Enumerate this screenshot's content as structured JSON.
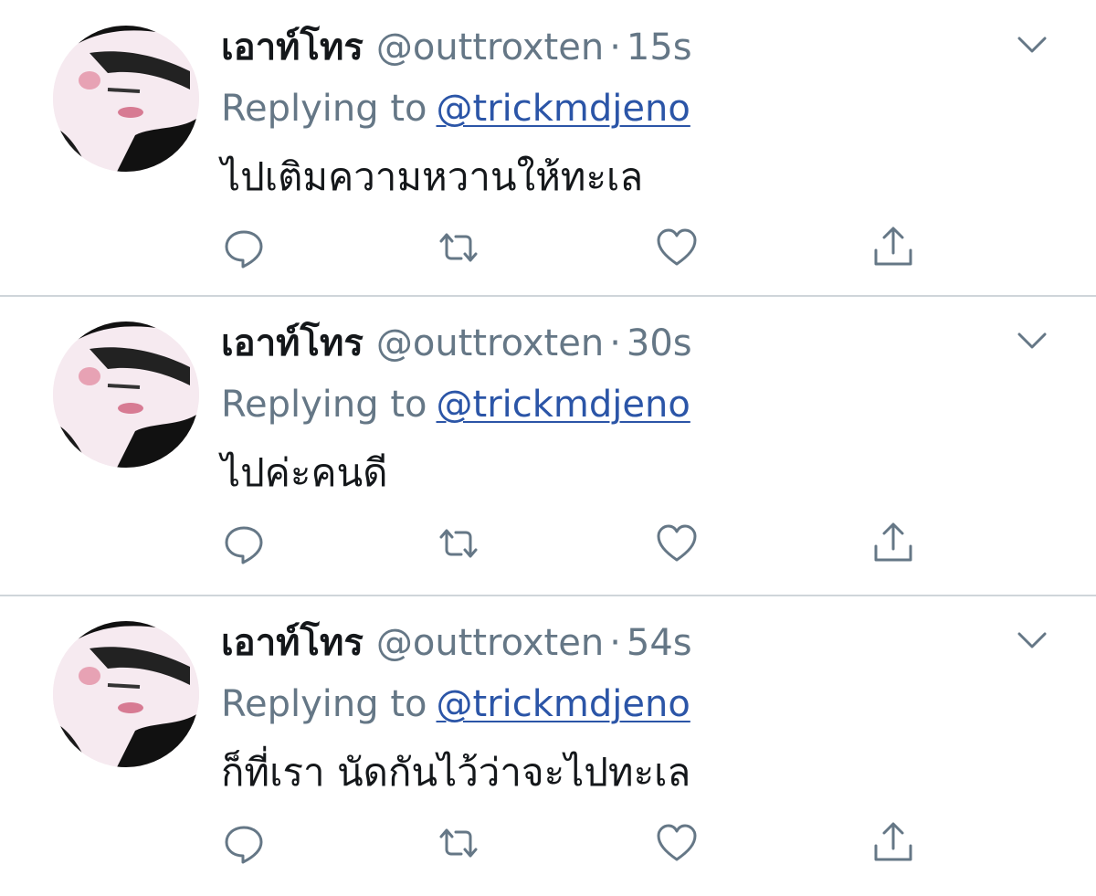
{
  "colors": {
    "name": "#14171a",
    "secondary": "#657786",
    "link": "#2b55a7",
    "divider": "#cfd5da",
    "icon": "#657786"
  },
  "icons": {
    "menu": "chevron-down-icon",
    "reply": "comment-bubble-icon",
    "retweet": "retweet-arrows-icon",
    "like": "heart-icon",
    "share": "share-upload-icon"
  },
  "tweets": [
    {
      "display_name": "เอาท์โทร",
      "handle": "@outtroxten",
      "separator": "·",
      "time": "15s",
      "replying_label": "Replying to",
      "replying_to": "@trickmdjeno",
      "text": "ไปเติมความหวานให้ทะเล"
    },
    {
      "display_name": "เอาท์โทร",
      "handle": "@outtroxten",
      "separator": "·",
      "time": "30s",
      "replying_label": "Replying to",
      "replying_to": "@trickmdjeno",
      "text": "ไปค่ะคนดี"
    },
    {
      "display_name": "เอาท์โทร",
      "handle": "@outtroxten",
      "separator": "·",
      "time": "54s",
      "replying_label": "Replying to",
      "replying_to": "@trickmdjeno",
      "text": "ก็ที่เรา นัดกันไว้ว่าจะไปทะเล"
    }
  ]
}
